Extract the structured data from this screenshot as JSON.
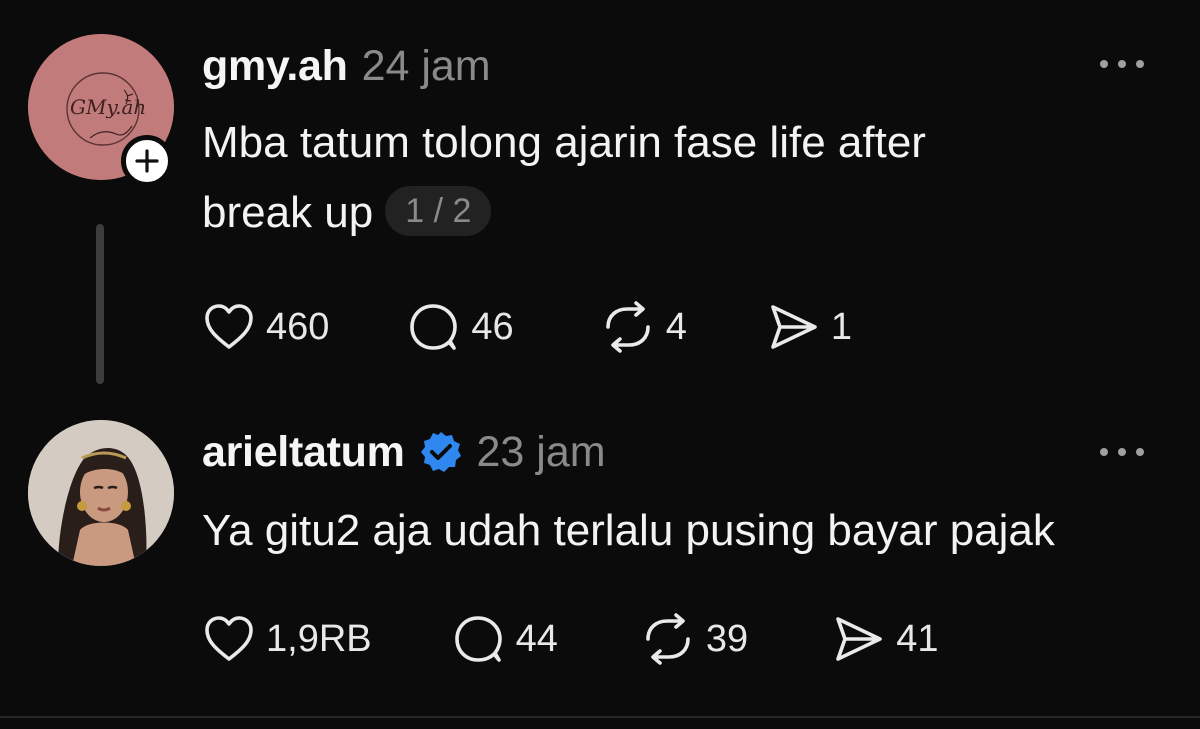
{
  "colors": {
    "background": "#0b0b0b",
    "text": "#f3f3f3",
    "muted": "#8a8a8a",
    "verified": "#2f88f0",
    "avatar_1": "#c27b7b"
  },
  "posts": [
    {
      "username": "gmy.ah",
      "time": "24 jam",
      "avatar_text": "GMy.ah",
      "text_line_1": "Mba tatum tolong ajarin fase life after",
      "text_line_2": "break up",
      "thread_page": "1 / 2",
      "likes": "460",
      "comments": "46",
      "reposts": "4",
      "shares": "1"
    },
    {
      "username": "arieltatum",
      "verified": true,
      "time": "23 jam",
      "text_line_1": "Ya gitu2 aja udah terlalu pusing bayar pajak",
      "likes": "1,9RB",
      "comments": "44",
      "reposts": "39",
      "shares": "41"
    }
  ]
}
